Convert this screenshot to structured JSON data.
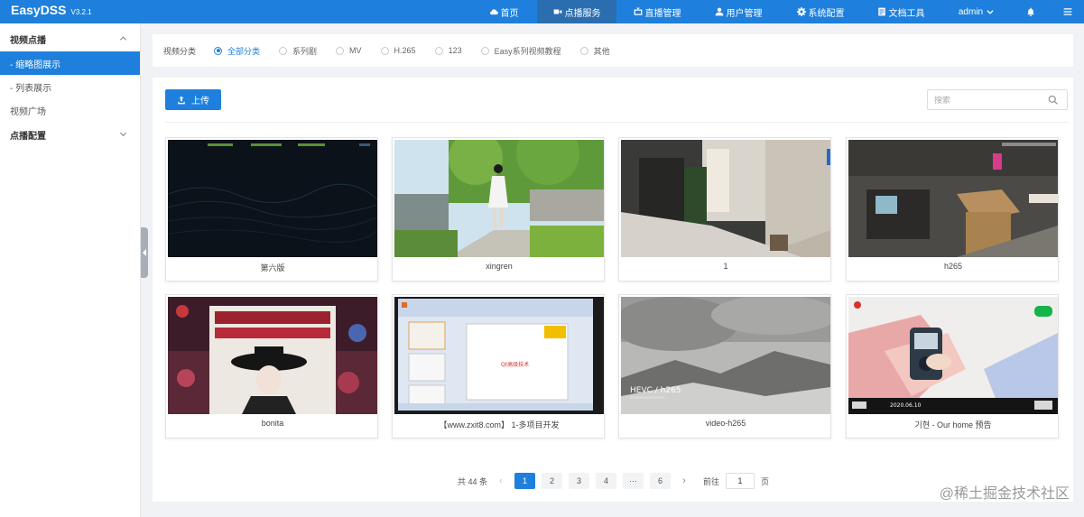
{
  "app": {
    "name": "EasyDSS",
    "version": "V3.2.1"
  },
  "nav": [
    {
      "label": "首页",
      "icon": "cloud-icon"
    },
    {
      "label": "点播服务",
      "icon": "video-camera-icon",
      "active": true
    },
    {
      "label": "直播管理",
      "icon": "tv-icon"
    },
    {
      "label": "用户管理",
      "icon": "user-icon"
    },
    {
      "label": "系统配置",
      "icon": "gear-icon"
    },
    {
      "label": "文档工具",
      "icon": "document-icon"
    }
  ],
  "user": {
    "name": "admin"
  },
  "sidebar": {
    "groups": [
      {
        "label": "视频点播",
        "expanded": true,
        "items": [
          "- 缩略图展示",
          "- 列表展示",
          "视频广场"
        ]
      },
      {
        "label": "点播配置",
        "expanded": false,
        "items": []
      }
    ],
    "active_item": "- 缩略图展示"
  },
  "filter": {
    "label": "视频分类",
    "options": [
      "全部分类",
      "系列剧",
      "MV",
      "H.265",
      "123",
      "Easy系列视频教程",
      "其他"
    ],
    "selected": "全部分类"
  },
  "toolbar": {
    "upload_label": "上传",
    "search_placeholder": "搜索"
  },
  "videos": [
    {
      "title": "第六版",
      "thumb": "dark-wave"
    },
    {
      "title": "xingren",
      "thumb": "girl-garden"
    },
    {
      "title": "1",
      "thumb": "office-corridor"
    },
    {
      "title": "h265",
      "thumb": "office-room"
    },
    {
      "title": "bonita",
      "thumb": "madonna-cover"
    },
    {
      "title": "【www.zxit8.com】 1-多项目开发",
      "thumb": "ppt-screen",
      "slide_text": "Qt高级技术"
    },
    {
      "title": "video-h265",
      "thumb": "cloudy-mountain",
      "overlay": "HEVC / h265"
    },
    {
      "title": "기현 - Our home 预告",
      "thumb": "hand-phone",
      "date": "2020.06.10"
    }
  ],
  "pagination": {
    "total_text": "共 44 条",
    "pages": [
      "1",
      "2",
      "3",
      "4",
      "···",
      "6"
    ],
    "current": "1",
    "goto_prefix": "前往",
    "goto_value": "1",
    "goto_suffix": "页"
  },
  "watermark": "@稀土掘金技术社区",
  "colors": {
    "primary": "#1e80dc",
    "nav_active": "#2b6eb0",
    "background": "#f0f2f5"
  }
}
